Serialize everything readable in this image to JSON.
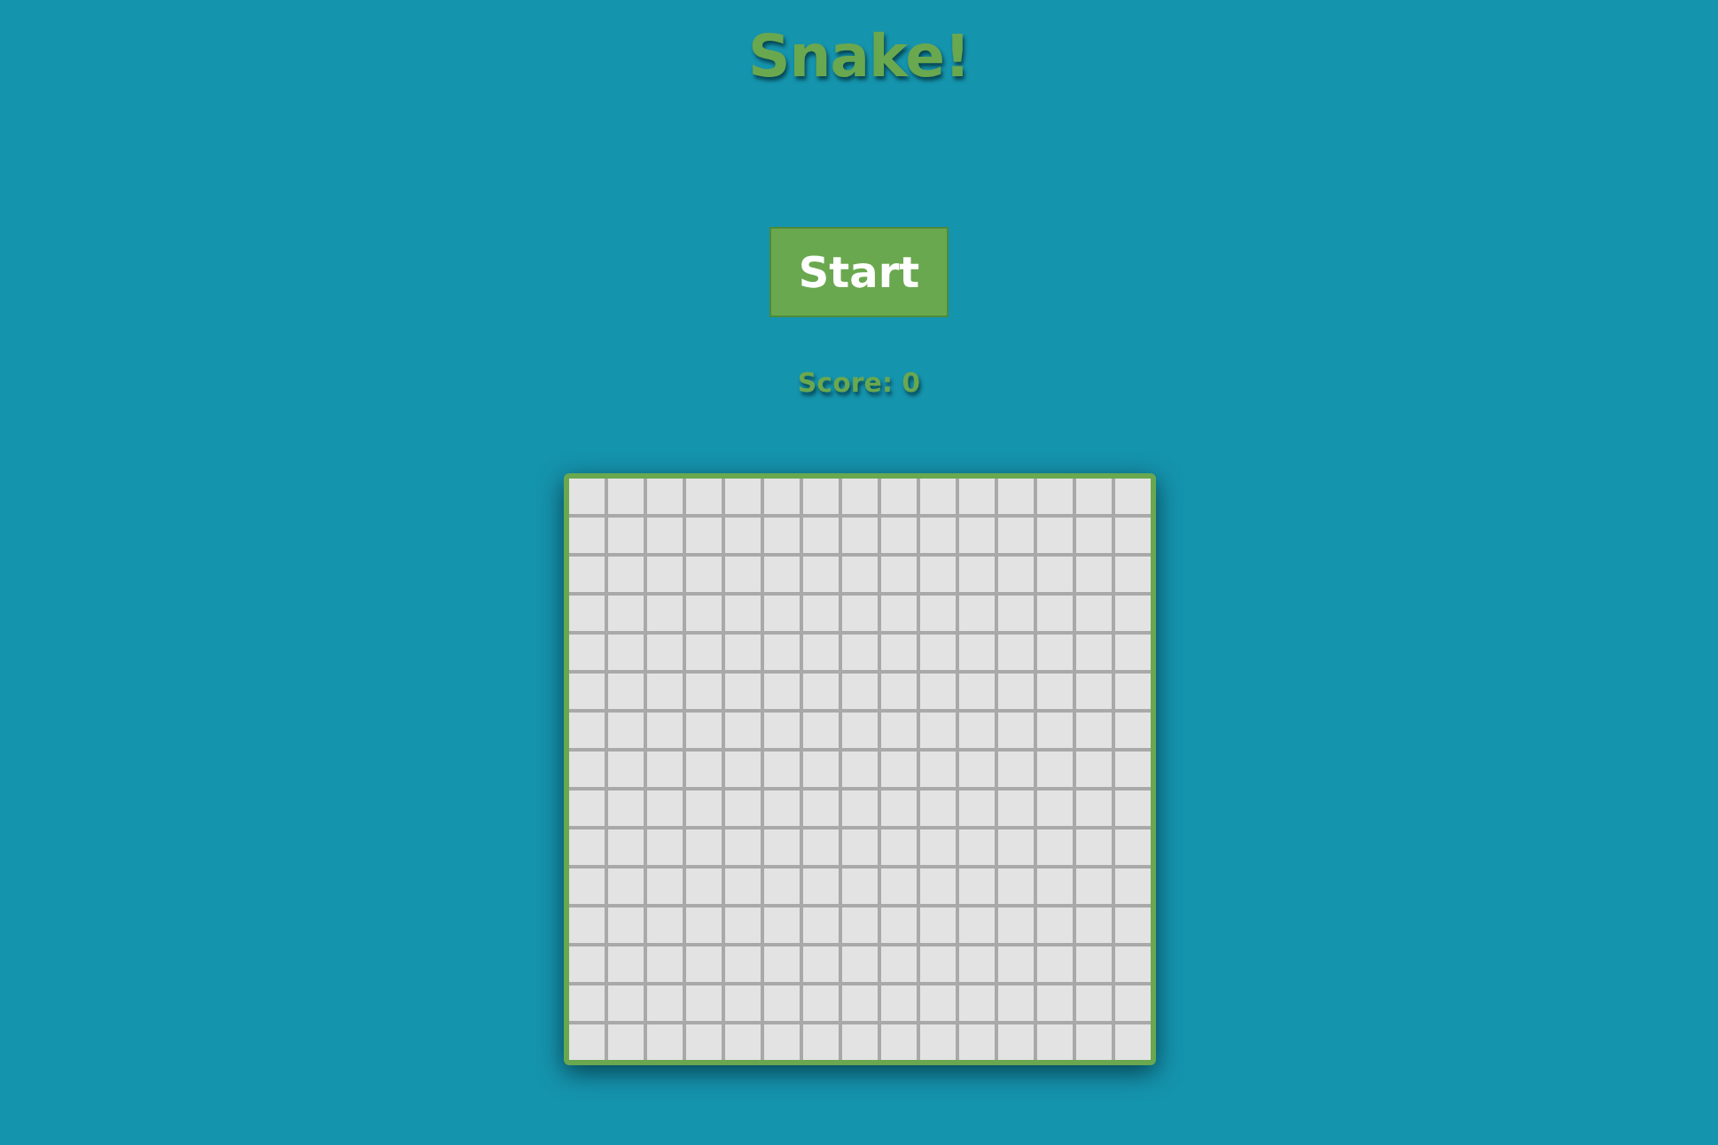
{
  "title": "Snake!",
  "start_button": {
    "label": "Start"
  },
  "score": {
    "text": "Score: 0"
  }
}
